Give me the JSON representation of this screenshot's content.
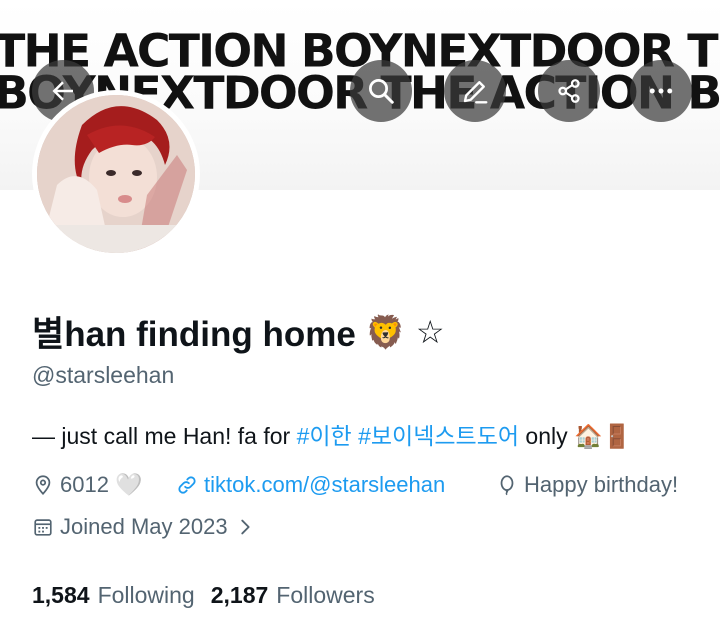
{
  "banner": {
    "line1": "THE  ACTION BOYNEXTDOOR THE  ACTION",
    "line2": "BOYNEXTDOOR THE  ACTION BOYNEXTDOOR"
  },
  "profile": {
    "display_name": "별han finding home",
    "name_emojis": "🦁 ☆",
    "handle": "@starsleehan",
    "bio": {
      "prefix": "— just call me Han! fa for ",
      "hashtag1": "#이한",
      "hashtag2": "#보이넥스트도어",
      "suffix": " only 🏠🚪"
    },
    "location": "6012 🤍",
    "website": "tiktok.com/@starsleehan",
    "birthday": "Happy birthday!",
    "joined": "Joined May 2023",
    "following_count": "1,584",
    "following_label": "Following",
    "followers_count": "2,187",
    "followers_label": "Followers"
  },
  "colors": {
    "accent": "#1d9bf0",
    "secondary_text": "#536471",
    "primary_text": "#0f1419"
  },
  "icons": [
    "back-arrow-icon",
    "search-icon",
    "edit-icon",
    "share-icon",
    "more-icon",
    "location-icon",
    "link-icon",
    "balloon-icon",
    "calendar-icon",
    "chevron-right-icon"
  ]
}
